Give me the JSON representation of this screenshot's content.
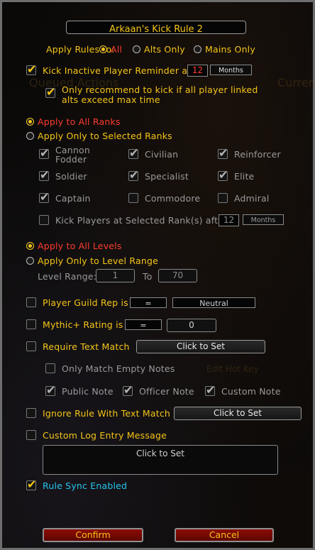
{
  "title": "Arkaan's Kick Rule 2",
  "apply_rules": {
    "label": "Apply Rules to:",
    "options": [
      "All",
      "Alts Only",
      "Mains Only"
    ],
    "selected": "All"
  },
  "kick_inactive": {
    "label": "Kick Inactive Player Reminder at",
    "value": "12",
    "unit": "Months",
    "checked": true
  },
  "only_recommend": {
    "line1": "Only recommend to kick if all player linked",
    "line2": "alts exceed max time",
    "checked": true
  },
  "ranks": {
    "apply_all": "Apply to All Ranks",
    "apply_selected": "Apply Only to Selected Ranks",
    "selected_mode": "all",
    "list": [
      {
        "line1": "Cannon",
        "line2": "Fodder",
        "checked": true
      },
      {
        "line1": "Civilian",
        "checked": true
      },
      {
        "line1": "Reinforcer",
        "checked": true
      },
      {
        "line1": "Soldier",
        "checked": true
      },
      {
        "line1": "Specialist",
        "checked": true
      },
      {
        "line1": "Elite",
        "checked": true
      },
      {
        "line1": "Captain",
        "checked": true
      },
      {
        "line1": "Commodore",
        "checked": false
      },
      {
        "line1": "Admiral",
        "checked": false
      }
    ],
    "kick_after": {
      "label": "Kick Players at Selected Rank(s) after",
      "value": "12",
      "unit": "Months",
      "checked": false
    }
  },
  "levels": {
    "apply_all": "Apply to All Levels",
    "apply_range": "Apply Only to Level Range",
    "range_label": "Level Range:",
    "from": "1",
    "to_label": "To",
    "to": "70"
  },
  "guild_rep": {
    "label": "Player Guild Rep is",
    "operator": "=",
    "value": "Neutral",
    "checked": false
  },
  "mythic": {
    "label": "Mythic+ Rating is",
    "operator": "=",
    "value": "0",
    "checked": false
  },
  "text_match": {
    "label": "Require Text Match",
    "button": "Click to Set",
    "checked": false,
    "only_empty": "Only Match Empty Notes",
    "notes": [
      {
        "label": "Public Note",
        "checked": true
      },
      {
        "label": "Officer Note",
        "checked": true
      },
      {
        "label": "Custom Note",
        "checked": true
      }
    ]
  },
  "ignore_rule": {
    "label": "Ignore Rule With Text Match",
    "button": "Click to Set",
    "checked": false
  },
  "custom_log": {
    "label": "Custom Log Entry Message",
    "button": "Click to Set",
    "checked": false
  },
  "rule_sync": {
    "label": "Rule Sync Enabled",
    "checked": true
  },
  "buttons": {
    "confirm": "Confirm",
    "cancel": "Cancel"
  },
  "background": {
    "queued_actions": "Queued Actions",
    "current": "Curren",
    "edit_hot_key": "Edit Hot Key"
  },
  "colors": {
    "gold": "#f5c518",
    "red_text": "#ff3b2f",
    "cyan_text": "#27c4ee",
    "button_red": "#8c0b04"
  }
}
